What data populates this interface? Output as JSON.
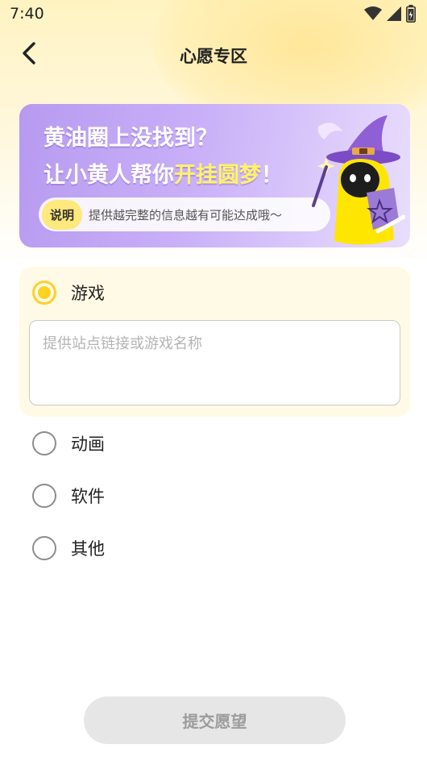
{
  "status_bar": {
    "time": "7:40",
    "icons": [
      "wifi-icon",
      "signal-icon",
      "battery-icon"
    ]
  },
  "header": {
    "title": "心愿专区",
    "back_icon": "chevron-left-icon"
  },
  "banner": {
    "line1": "黄油圈上没找到？",
    "line2_prefix": "让小黄人帮你",
    "line2_highlight": "开挂圆梦",
    "line2_suffix": "！",
    "note_tag": "说明",
    "note_text": "提供越完整的信息越有可能达成哦～"
  },
  "options": [
    {
      "label": "游戏",
      "selected": true
    },
    {
      "label": "动画",
      "selected": false
    },
    {
      "label": "软件",
      "selected": false
    },
    {
      "label": "其他",
      "selected": false
    }
  ],
  "game_input": {
    "placeholder": "提供站点链接或游戏名称",
    "value": ""
  },
  "submit": {
    "label": "提交愿望"
  },
  "colors": {
    "accent_yellow": "#ffd21f",
    "banner_purple": "#b79af0",
    "selected_card_bg": "#fffae5",
    "disabled_button_bg": "#e6e6e6"
  }
}
